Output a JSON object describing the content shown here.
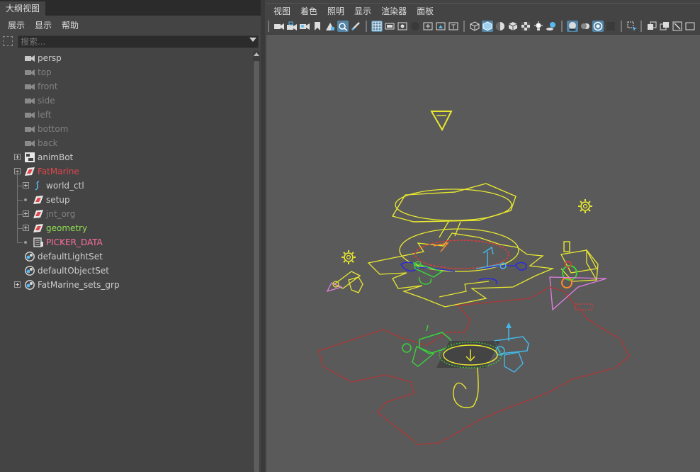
{
  "outliner": {
    "tab_title": "大纲视图",
    "menus": [
      "展示",
      "显示",
      "帮助"
    ],
    "search_placeholder": "搜索...",
    "items": [
      {
        "label": "persp",
        "color": "#cccccc"
      },
      {
        "label": "top",
        "color": "#808080"
      },
      {
        "label": "front",
        "color": "#808080"
      },
      {
        "label": "side",
        "color": "#808080"
      },
      {
        "label": "left",
        "color": "#808080"
      },
      {
        "label": "bottom",
        "color": "#808080"
      },
      {
        "label": "back",
        "color": "#808080"
      },
      {
        "label": "animBot",
        "color": "#cccccc"
      },
      {
        "label": "FatMarine",
        "color": "#e0474c"
      },
      {
        "label": "world_ctl",
        "color": "#cccccc"
      },
      {
        "label": "setup",
        "color": "#cccccc"
      },
      {
        "label": "jnt_org",
        "color": "#808080"
      },
      {
        "label": "geometry",
        "color": "#8fe04f"
      },
      {
        "label": "PICKER_DATA",
        "color": "#ff6fa0"
      },
      {
        "label": "defaultLightSet",
        "color": "#cccccc"
      },
      {
        "label": "defaultObjectSet",
        "color": "#cccccc"
      },
      {
        "label": "FatMarine_sets_grp",
        "color": "#cccccc"
      }
    ]
  },
  "viewport_panel": {
    "menus": [
      "视图",
      "着色",
      "照明",
      "显示",
      "渲染器",
      "面板"
    ],
    "accent_color": "#5285a6",
    "viewport_bg": "#5a5a5a"
  }
}
